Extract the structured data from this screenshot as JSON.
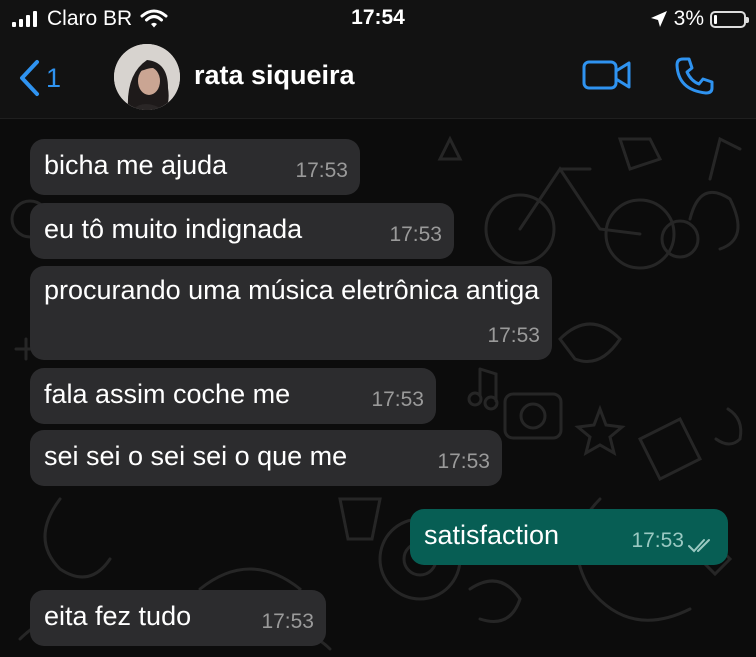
{
  "status_bar": {
    "carrier": "Claro BR",
    "time": "17:54",
    "battery_percent": "3%",
    "battery_level": 0.03,
    "icons": [
      "signal-bars-icon",
      "wifi-icon",
      "location-arrow-icon",
      "battery-icon"
    ]
  },
  "header": {
    "back_count": "1",
    "contact_name": "rata siqueira",
    "icons": [
      "back-chevron-icon",
      "video-call-icon",
      "phone-icon"
    ]
  },
  "colors": {
    "accent": "#2f93f0",
    "incoming_bubble": "#2c2c2e",
    "outgoing_bubble": "#075e54",
    "chat_background": "#0c0c0c"
  },
  "messages": [
    {
      "direction": "incoming",
      "text": "bicha me ajuda",
      "time": "17:53"
    },
    {
      "direction": "incoming",
      "text": "eu tô muito indignada",
      "time": "17:53"
    },
    {
      "direction": "incoming",
      "text": "procurando uma música eletrônica antiga",
      "time": "17:53"
    },
    {
      "direction": "incoming",
      "text": "fala assim coche me",
      "time": "17:53"
    },
    {
      "direction": "incoming",
      "text": "sei sei o sei sei o que me",
      "time": "17:53"
    },
    {
      "direction": "outgoing",
      "text": "satisfaction",
      "time": "17:53",
      "status": "read"
    },
    {
      "direction": "incoming",
      "text": "eita fez tudo",
      "time": "17:53"
    }
  ]
}
